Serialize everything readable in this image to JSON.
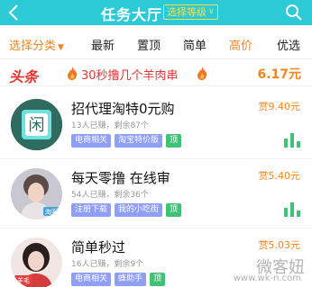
{
  "header": {
    "title": "任务大厅",
    "level_button": "选择等级",
    "colors": {
      "bar": "#2ccad6",
      "accent": "#f4e04a"
    }
  },
  "filters": [
    {
      "label": "选择分类",
      "active": true
    },
    {
      "label": "最新",
      "active": false
    },
    {
      "label": "置顶",
      "active": false
    },
    {
      "label": "简单",
      "active": false
    },
    {
      "label": "高价",
      "active": true
    },
    {
      "label": "优选",
      "active": false
    }
  ],
  "banner": {
    "tag": "头条",
    "text": "30秒撸几个羊肉串",
    "amount": "6.17元"
  },
  "tasks": [
    {
      "title": "招代理淘特0元购",
      "sub": "13人已赚，剩余87个",
      "reward": "赏9.40元",
      "tags": [
        "电商相关",
        "淘宝特价版",
        "顶"
      ]
    },
    {
      "title": "每天零撸 在线审",
      "sub": "54人已赚，剩余36个",
      "reward": "赏5.40元",
      "tags": [
        "注册下载",
        "我的小吃街",
        "顶"
      ]
    },
    {
      "title": "简单秒过",
      "sub": "16人已赚，剩余9个",
      "reward": "赏5.03元",
      "tags": [
        "电商相关",
        "蜂助手",
        "顶"
      ]
    }
  ],
  "avatars": {
    "task0_icon_text": "闲",
    "task1_badge": "淘客",
    "task2_badge": "羊毛"
  },
  "watermark": {
    "text": "微客妞",
    "url": "www.wk-n.com"
  }
}
